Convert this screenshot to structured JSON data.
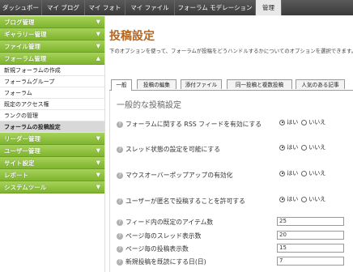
{
  "topnav": {
    "tabs": [
      "ダッシュボード",
      "マイ ブログ",
      "マイ フォト",
      "マイ ファイル",
      "フォーラム モデレーション",
      "管理"
    ],
    "active": "管理"
  },
  "sidebar": {
    "sections_top": [
      "ブログ管理",
      "ギャラリー管理",
      "ファイル管理",
      "フォーラム管理"
    ],
    "forum_items": [
      "新規フォーラムの作成",
      "フォーラムグループ",
      "フォーラム",
      "既定のアクセス権",
      "ランクの管理",
      "フォーラムの投稿設定"
    ],
    "selected_item": "フォーラムの投稿設定",
    "sections_bottom": [
      "リーダー管理",
      "ユーザー管理",
      "サイト設定",
      "レポート",
      "システムツール"
    ]
  },
  "main": {
    "title": "投稿設定",
    "description": "下のオプションを使って、フォーラムが投稿をどうハンドルするかについてのオプションを選択できます。",
    "tabs": [
      "一般",
      "投稿の編集",
      "添付ファイル",
      "同一投稿と複数投稿",
      "人気のある記事"
    ],
    "active_tab": "一般",
    "heading": "一般的な投稿設定",
    "settings": [
      {
        "label": "フォーラムに関する RSS フィードを有効にする",
        "yes": "はい",
        "no": "いいえ",
        "value": "yes"
      },
      {
        "label": "スレッド状態の設定を可能にする",
        "yes": "はい",
        "no": "いいえ",
        "value": "yes"
      },
      {
        "label": "マウスオーバーポップアップの有効化",
        "yes": "はい",
        "no": "いいえ",
        "value": "yes"
      },
      {
        "label": "ユーザーが匿名で投稿することを許可する",
        "yes": "はい",
        "no": "いいえ",
        "value": "yes"
      }
    ],
    "fields": [
      {
        "label": "フィード内の既定のアイテム数",
        "value": "25"
      },
      {
        "label": "ページ毎のスレッド表示数",
        "value": "20"
      },
      {
        "label": "ページ毎の投稿表示数",
        "value": "15"
      },
      {
        "label": "新規投稿を既読にする日(日)",
        "value": "7"
      }
    ]
  }
}
